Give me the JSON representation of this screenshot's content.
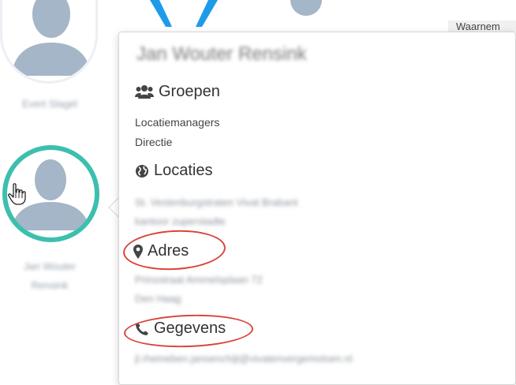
{
  "background": {
    "person1": {
      "name": "Evert Slagel"
    },
    "person2": {
      "name_line1": "Jan Wouter",
      "name_line2": "Rensink"
    },
    "right_label": "Waarnem"
  },
  "popover": {
    "title": "Jan Wouter Rensink",
    "groepen": {
      "heading": "Groepen",
      "items": [
        "Locatiemanagers",
        "Directie"
      ]
    },
    "locaties": {
      "heading": "Locaties",
      "items": [
        "St. Vestenburgstraten Vivat Brabant",
        "kantoor zuperstadte"
      ]
    },
    "adres": {
      "heading": "Adres",
      "lines": [
        "Prinsstraat Ammelsplaan 72",
        "Den Haag"
      ]
    },
    "gegevens": {
      "heading": "Gegevens",
      "lines": [
        "jl.rheineben.jansenchijt@vivatenvergemotsen.nl"
      ]
    }
  },
  "colors": {
    "accent_ring": "#3dbfae",
    "annotation": "#d9443b",
    "avatar": "#a4b6c8",
    "logo_blue": "#1e9be8"
  }
}
